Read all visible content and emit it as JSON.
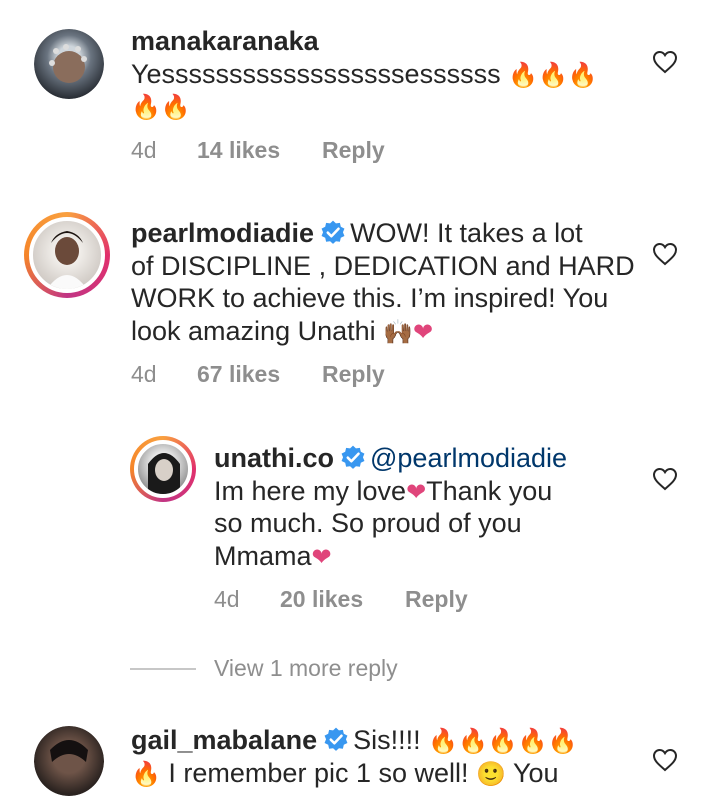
{
  "comments": [
    {
      "username": "manakaranaka",
      "verified": false,
      "text": "Yessssssssssssssssssessssss",
      "emoji": "🔥🔥🔥🔥🔥",
      "age": "4d",
      "likes": "14 likes",
      "reply": "Reply"
    },
    {
      "username": "pearlmodiadie",
      "verified": true,
      "text_line1": "WOW! It takes a lot",
      "text_line2": "of DISCIPLINE , DEDICATION and HARD",
      "text_line3": "WORK to achieve this. I’m inspired! You",
      "text_line4": "look amazing Unathi",
      "emoji": "🙌🏾❤",
      "age": "4d",
      "likes": "67 likes",
      "reply": "Reply"
    },
    {
      "username": "unathi.co",
      "verified": true,
      "mention": "@pearlmodiadie",
      "text_line1a": "Im here my love",
      "text_line1b": "Thank you",
      "text_line2": "so much. So proud of you",
      "text_line3": "Mmama",
      "age": "4d",
      "likes": "20 likes",
      "reply": "Reply"
    },
    {
      "username": "gail_mabalane",
      "verified": true,
      "text_line1": "Sis!!!!",
      "emoji_line1": "🔥🔥🔥🔥🔥",
      "text_line2": "I remember pic 1 so well!",
      "text_line2_end": "You"
    }
  ],
  "view_more": "View 1 more reply",
  "colors": {
    "accent_heart": "#e0457b",
    "verified_blue": "#3897f0",
    "meta_gray": "#8e8e8e"
  }
}
